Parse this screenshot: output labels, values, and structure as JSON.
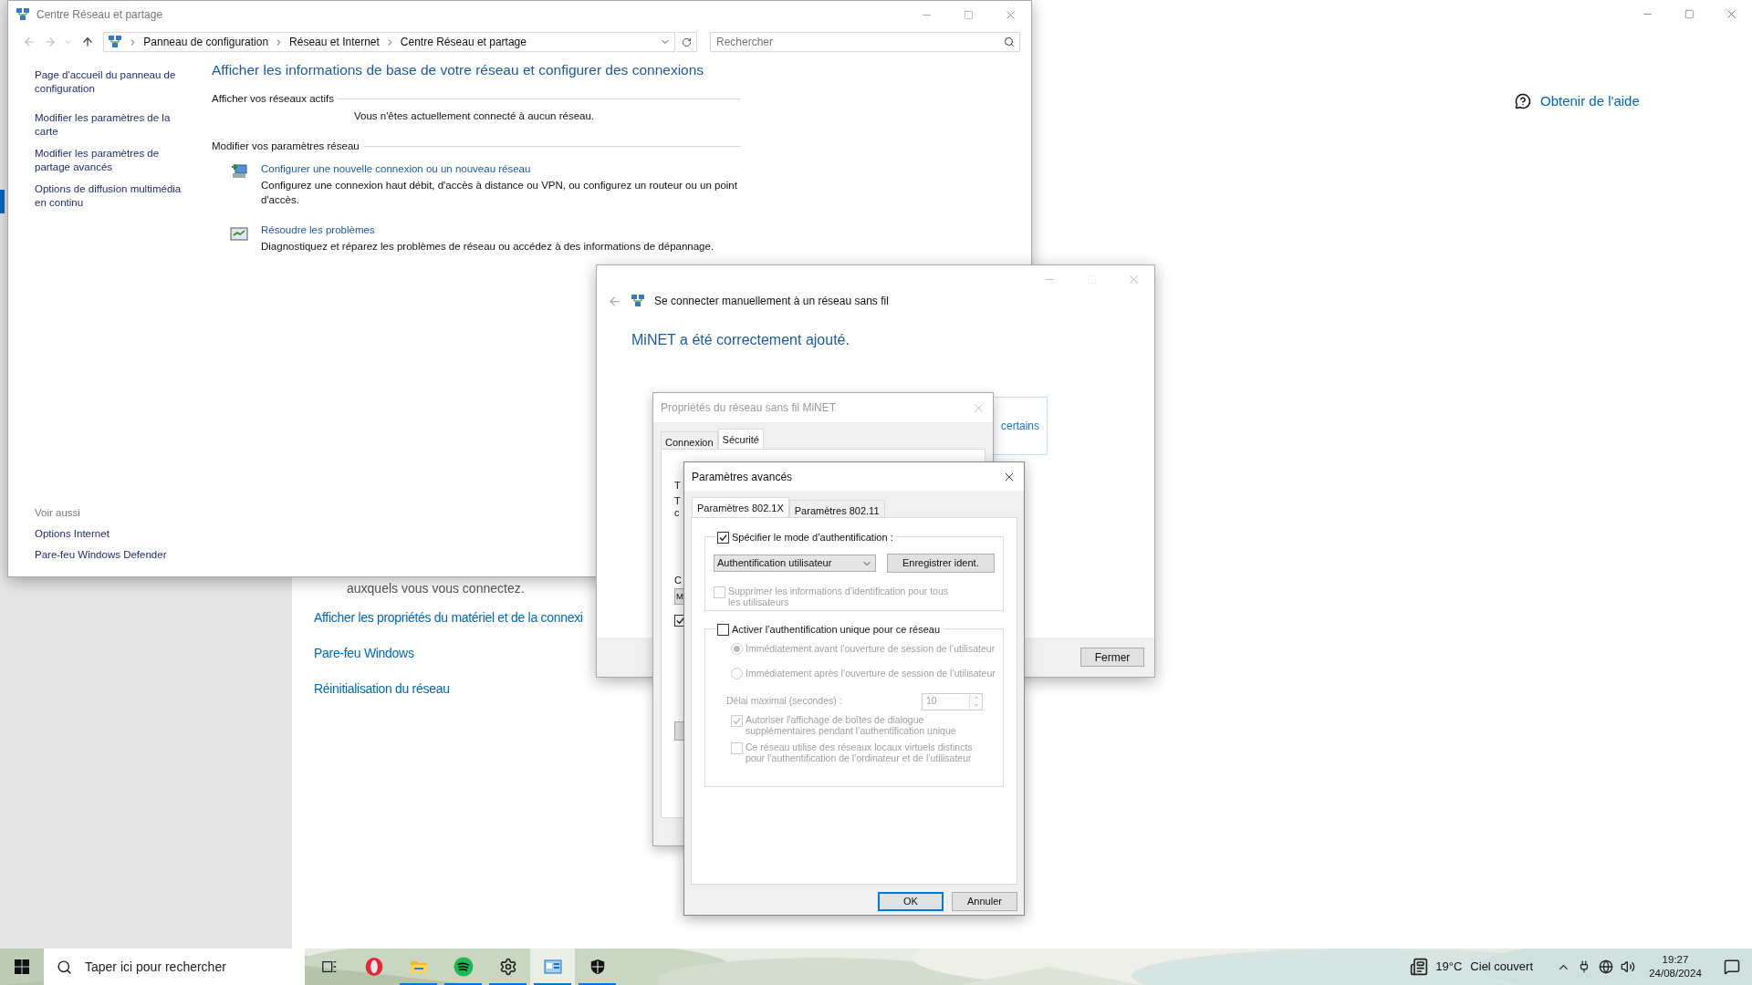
{
  "settings_window": {
    "help_link": "Obtenir de l'aide",
    "partial_text": "auxquels vous vous connectez.",
    "links": [
      "Afficher les propriétés du matériel et de la connexi",
      "Pare-feu Windows",
      "Réinitialisation du réseau"
    ]
  },
  "control_panel": {
    "title": "Centre Réseau et partage",
    "breadcrumb": [
      "Panneau de configuration",
      "Réseau et Internet",
      "Centre Réseau et partage"
    ],
    "search": {
      "placeholder": "Rechercher"
    },
    "sidebar": {
      "items": [
        "Page d'accueil du panneau de configuration",
        "Modifier les paramètres de la carte",
        "Modifier les paramètres de partage avancés",
        "Options de diffusion multimédia en continu"
      ],
      "see_also": {
        "heading": "Voir aussi",
        "items": [
          "Options Internet",
          "Pare-feu Windows Defender"
        ]
      }
    },
    "heading": "Afficher les informations de base de votre réseau et configurer des connexions",
    "active_networks": {
      "title": "Afficher vos réseaux actifs",
      "message": "Vous n'êtes actuellement connecté à aucun réseau."
    },
    "change_settings": {
      "title": "Modifier vos paramètres réseau",
      "tasks": [
        {
          "kind": "setup",
          "link": "Configurer une nouvelle connexion ou un nouveau réseau",
          "description": "Configurez une connexion haut débit, d'accès à distance ou VPN, ou configurez un routeur ou un point d'accès."
        },
        {
          "kind": "troubleshoot",
          "link": "Résoudre les problèmes",
          "description": "Diagnostiquez et réparez les problèmes de réseau ou accédez à des informations de dépannage."
        }
      ]
    }
  },
  "wizard": {
    "title": "Se connecter manuellement à un réseau sans fil",
    "message": "MiNET a été correctement ajouté.",
    "partial_link": "certains",
    "close_button": "Fermer"
  },
  "properties_dialog": {
    "title": "Propriétés du réseau sans fil MiNET",
    "tabs": [
      {
        "label": "Connexion",
        "selected": false
      },
      {
        "label": "Sécurité",
        "selected": true
      }
    ],
    "partial_texts": [
      "T",
      "T",
      "c",
      "C"
    ],
    "partial_field": "M",
    "partial_checkbox": {
      "checked": true
    }
  },
  "advanced_dialog": {
    "title": "Paramètres avancés",
    "tabs": [
      {
        "label": "Paramètres 802.1X",
        "selected": true
      },
      {
        "label": "Paramètres 802.11",
        "selected": false
      }
    ],
    "specify_mode": {
      "label": "Spécifier le mode d’authentification :",
      "checked": true
    },
    "auth_mode": {
      "value": "Authentification utilisateur"
    },
    "save_credentials_button": "Enregistrer ident.",
    "delete_credentials": {
      "label": "Supprimer les informations d’identification pour tous les utilisateurs",
      "checked": false,
      "disabled": true
    },
    "sso": {
      "label": "Activer l’authentification unique pour ce réseau",
      "checked": false
    },
    "sso_timing": [
      {
        "label": "Immédiatement avant l’ouverture de session de l’utilisateur",
        "selected": true,
        "disabled": true
      },
      {
        "label": "Immédiatement après l’ouverture de session de l’utilisateur",
        "selected": false,
        "disabled": true
      }
    ],
    "max_delay": {
      "label": "Délai maximal (secondes) :",
      "value": "10",
      "disabled": true
    },
    "sso_options": [
      {
        "label": "Autoriser l’affichage de boîtes de dialogue supplémentaires pendant l’authentification unique",
        "checked": true,
        "disabled": true
      },
      {
        "label": "Ce réseau utilise des réseaux locaux virtuels distincts pour l’authentification de l’ordinateur et de l’utilisateur",
        "checked": false,
        "disabled": true
      }
    ],
    "buttons": [
      "OK",
      "Annuler"
    ]
  },
  "taskbar": {
    "search": {
      "placeholder": "Taper ici pour rechercher"
    },
    "apps": [
      {
        "kind": "task-view",
        "running": false,
        "active": false
      },
      {
        "kind": "opera",
        "running": false,
        "active": false
      },
      {
        "kind": "explorer",
        "running": true,
        "active": false
      },
      {
        "kind": "spotify",
        "running": true,
        "active": false
      },
      {
        "kind": "settings",
        "running": true,
        "active": false
      },
      {
        "kind": "control-panel",
        "running": true,
        "active": true
      },
      {
        "kind": "defender",
        "running": true,
        "active": false
      }
    ],
    "weather": {
      "temperature": "19°C",
      "condition": "Ciel couvert"
    },
    "clock": {
      "time": "19:27",
      "date": "24/08/2024"
    }
  }
}
